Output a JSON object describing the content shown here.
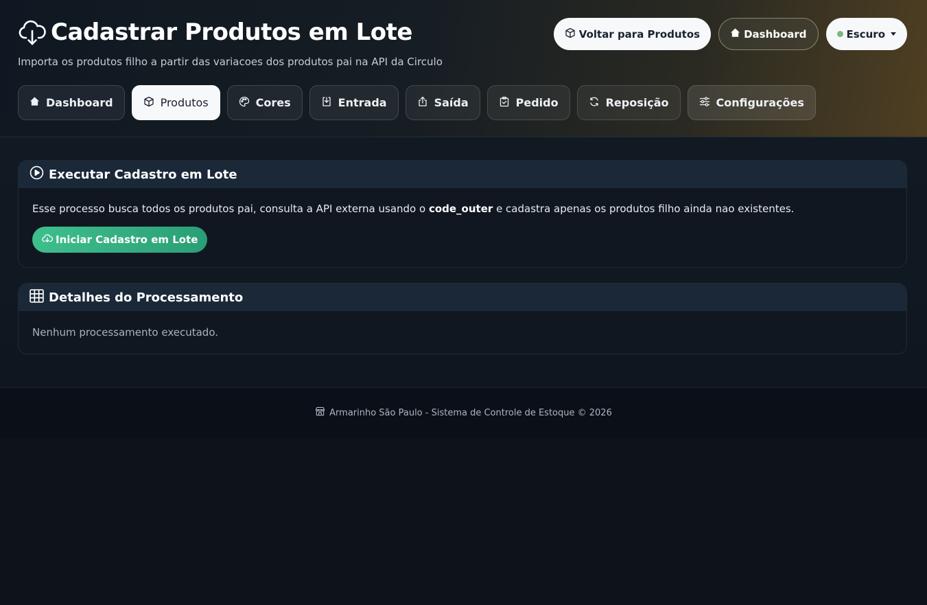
{
  "header": {
    "title": "Cadastrar Produtos em Lote",
    "subtitle": "Importa os produtos filho a partir das variacoes dos produtos pai na API da Circulo",
    "title_icon": "cloud-download-icon",
    "actions": {
      "back_label": "Voltar para Produtos",
      "dashboard_label": "Dashboard",
      "theme_label": "Escuro"
    }
  },
  "nav": {
    "items": [
      {
        "label": "Dashboard",
        "icon": "home-icon"
      },
      {
        "label": "Produtos",
        "icon": "box-icon"
      },
      {
        "label": "Cores",
        "icon": "palette-icon"
      },
      {
        "label": "Entrada",
        "icon": "download-tray-icon"
      },
      {
        "label": "Saída",
        "icon": "upload-tray-icon"
      },
      {
        "label": "Pedido",
        "icon": "clipboard-check-icon"
      },
      {
        "label": "Reposição",
        "icon": "refresh-icon"
      },
      {
        "label": "Configurações",
        "icon": "sliders-icon"
      }
    ],
    "active": "Produtos"
  },
  "execute_card": {
    "title": "Executar Cadastro em Lote",
    "desc_before": "Esse processo busca todos os produtos pai, consulta a API externa usando o ",
    "desc_code": "code_outer",
    "desc_after": " e cadastra apenas os produtos filho ainda nao existentes.",
    "button_label": "Iniciar Cadastro em Lote"
  },
  "details_card": {
    "title": "Detalhes do Processamento",
    "empty_text": "Nenhum processamento executado."
  },
  "footer": {
    "text": "Armarinho São Paulo - Sistema de Controle de Estoque © 2026"
  },
  "colors": {
    "accent_green": "#3fbf8c",
    "status_dot": "#7ab87f",
    "card_header": "#1a2838"
  }
}
